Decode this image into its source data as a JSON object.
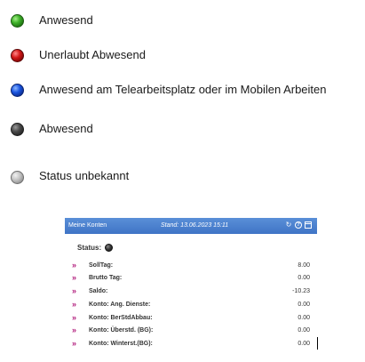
{
  "legend": {
    "items": [
      {
        "color_name": "green",
        "color": "#3fb32a",
        "label": "Anwesend"
      },
      {
        "color_name": "red",
        "color": "#d21818",
        "label": "Unerlaubt Abwesend"
      },
      {
        "color_name": "blue",
        "color": "#1a55e0",
        "label": "Anwesend am Telearbeitsplatz oder im Mobilen Arbeiten"
      },
      {
        "color_name": "dark-gray",
        "color": "#4a4a4a",
        "label": "Abwesend"
      },
      {
        "color_name": "light-gray",
        "color": "#c4c4c4",
        "label": "Status unbekannt"
      }
    ]
  },
  "widget": {
    "header": {
      "title": "Meine Konten",
      "stand": "Stand: 13.06.2023 15:11",
      "icons": [
        "refresh-icon",
        "help-icon",
        "window-icon"
      ],
      "background": "#4a80cf"
    },
    "status": {
      "label": "Status:",
      "indicator": "dark-gray"
    },
    "rows": [
      {
        "label": "SollTag:",
        "value": "8.00"
      },
      {
        "label": "Brutto Tag:",
        "value": "0.00"
      },
      {
        "label": "Saldo:",
        "value": "-10.23"
      },
      {
        "label": "Konto: Ang. Dienste:",
        "value": "0.00"
      },
      {
        "label": "Konto: BerStdAbbau:",
        "value": "0.00"
      },
      {
        "label": "Konto: Überstd. (BG):",
        "value": "0.00"
      },
      {
        "label": "Konto: Winterst.(BG):",
        "value": "0.00"
      }
    ],
    "row_marker": "»",
    "marker_color": "#b0197a"
  }
}
